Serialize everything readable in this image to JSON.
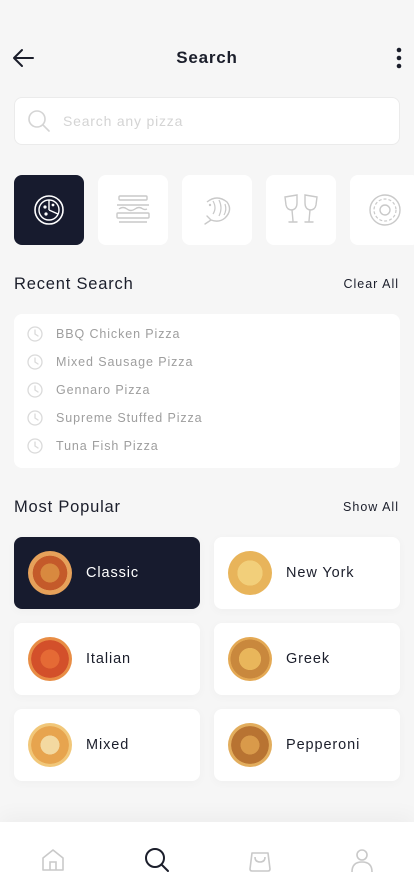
{
  "header": {
    "title": "Search"
  },
  "search": {
    "placeholder": "Search any pizza",
    "value": ""
  },
  "categories": [
    {
      "icon": "pizza-icon",
      "active": true
    },
    {
      "icon": "burger-icon",
      "active": false
    },
    {
      "icon": "shrimp-icon",
      "active": false
    },
    {
      "icon": "wine-glasses-icon",
      "active": false
    },
    {
      "icon": "donut-icon",
      "active": false
    }
  ],
  "recent": {
    "title": "Recent Search",
    "action": "Clear All",
    "items": [
      {
        "label": "BBQ Chicken Pizza"
      },
      {
        "label": "Mixed Sausage Pizza"
      },
      {
        "label": "Gennaro Pizza"
      },
      {
        "label": "Supreme Stuffed Pizza"
      },
      {
        "label": "Tuna Fish Pizza"
      }
    ]
  },
  "popular": {
    "title": "Most Popular",
    "action": "Show All",
    "items": [
      {
        "label": "Classic",
        "active": true
      },
      {
        "label": "New York",
        "active": false
      },
      {
        "label": "Italian",
        "active": false
      },
      {
        "label": "Greek",
        "active": false
      },
      {
        "label": "Mixed",
        "active": false
      },
      {
        "label": "Pepperoni",
        "active": false
      }
    ]
  },
  "nav": [
    {
      "icon": "home-icon",
      "active": false
    },
    {
      "icon": "search-icon",
      "active": true
    },
    {
      "icon": "shopping-bag-icon",
      "active": false
    },
    {
      "icon": "profile-icon",
      "active": false
    }
  ],
  "colors": {
    "accent": "#171b2e",
    "background": "#f6f6f6",
    "muted": "#9e9e9e",
    "inactive_icon": "#c9c9c9"
  }
}
